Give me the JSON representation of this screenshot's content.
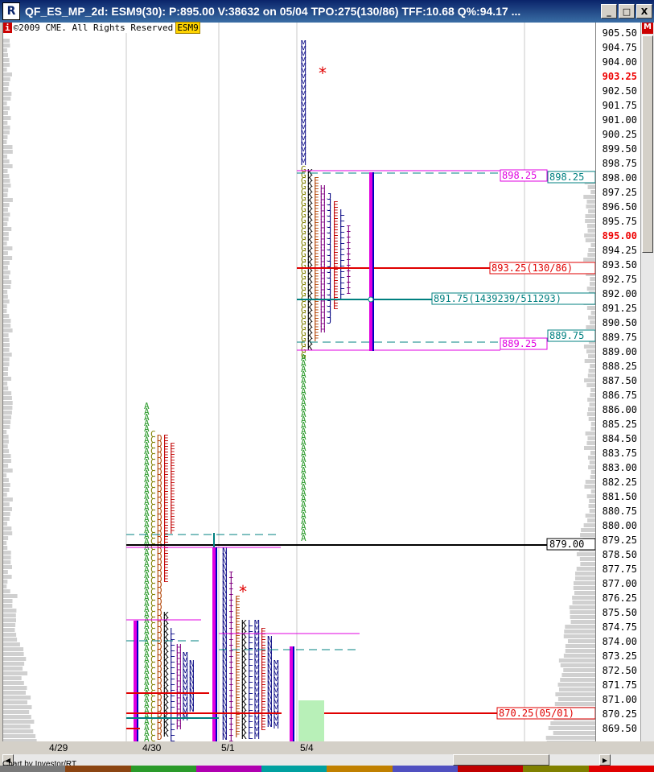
{
  "window": {
    "title": "QF_ES_MP_2d: ESM9(30): P:895.00 V:38632 on 05/04 TPO:275(130/86)   TFF:10.68 Q%:94.17 ...",
    "app_icon": "R",
    "min_glyph": "_",
    "max_glyph": "□",
    "close_glyph": "X"
  },
  "header": {
    "info_badge": "i",
    "copyright": "©2009 CME. All Rights Reserved",
    "symbol": "ESM9"
  },
  "right_badge": "M",
  "price_axis": {
    "ticks": [
      "905.50",
      "904.75",
      "904.00",
      "903.25",
      "902.50",
      "901.75",
      "901.00",
      "900.25",
      "899.50",
      "898.75",
      "898.00",
      "897.25",
      "896.50",
      "895.75",
      "895.00",
      "894.25",
      "893.50",
      "892.75",
      "892.00",
      "891.25",
      "890.50",
      "889.75",
      "889.00",
      "888.25",
      "887.50",
      "886.75",
      "886.00",
      "885.25",
      "884.50",
      "883.75",
      "883.00",
      "882.25",
      "881.50",
      "880.75",
      "880.00",
      "879.25",
      "878.50",
      "877.75",
      "877.00",
      "876.25",
      "875.50",
      "874.75",
      "874.00",
      "873.25",
      "872.50",
      "871.75",
      "871.00",
      "870.25",
      "869.50"
    ],
    "highlighted": [
      "903.25",
      "895.00"
    ],
    "highlight_color": "#e00000"
  },
  "date_axis": {
    "ticks": [
      "4/29",
      "4/30",
      "5/1",
      "5/4"
    ]
  },
  "footer": {
    "credit": "Chart by Investor/RT"
  },
  "annotations": {
    "va_high_label": "898.25",
    "va_high_right": "898.25",
    "poc_label": "893.25(130/86)",
    "vwap_label": "891.75(1439239/511293)",
    "va_low_right": "889.75",
    "va_low_label": "889.25",
    "prior_close": "879.00",
    "prior_poc": "870.25(05/01)"
  },
  "colors": {
    "magenta": "#e000e0",
    "red": "#e00000",
    "teal": "#008080",
    "black": "#000000",
    "green_box": "#b8f0b8"
  }
}
